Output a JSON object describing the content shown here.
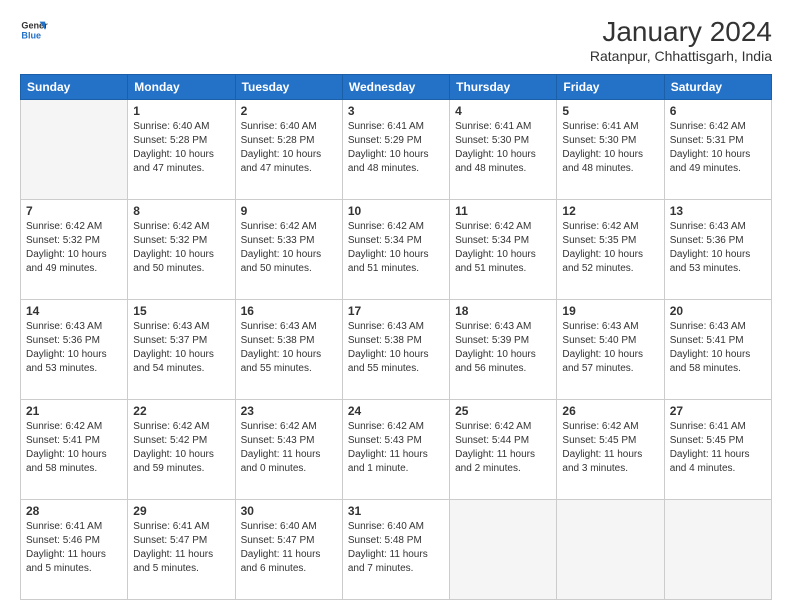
{
  "header": {
    "logo_line1": "General",
    "logo_line2": "Blue",
    "month_year": "January 2024",
    "location": "Ratanpur, Chhattisgarh, India"
  },
  "weekdays": [
    "Sunday",
    "Monday",
    "Tuesday",
    "Wednesday",
    "Thursday",
    "Friday",
    "Saturday"
  ],
  "weeks": [
    [
      {
        "day": "",
        "info": ""
      },
      {
        "day": "1",
        "info": "Sunrise: 6:40 AM\nSunset: 5:28 PM\nDaylight: 10 hours\nand 47 minutes."
      },
      {
        "day": "2",
        "info": "Sunrise: 6:40 AM\nSunset: 5:28 PM\nDaylight: 10 hours\nand 47 minutes."
      },
      {
        "day": "3",
        "info": "Sunrise: 6:41 AM\nSunset: 5:29 PM\nDaylight: 10 hours\nand 48 minutes."
      },
      {
        "day": "4",
        "info": "Sunrise: 6:41 AM\nSunset: 5:30 PM\nDaylight: 10 hours\nand 48 minutes."
      },
      {
        "day": "5",
        "info": "Sunrise: 6:41 AM\nSunset: 5:30 PM\nDaylight: 10 hours\nand 48 minutes."
      },
      {
        "day": "6",
        "info": "Sunrise: 6:42 AM\nSunset: 5:31 PM\nDaylight: 10 hours\nand 49 minutes."
      }
    ],
    [
      {
        "day": "7",
        "info": "Sunrise: 6:42 AM\nSunset: 5:32 PM\nDaylight: 10 hours\nand 49 minutes."
      },
      {
        "day": "8",
        "info": "Sunrise: 6:42 AM\nSunset: 5:32 PM\nDaylight: 10 hours\nand 50 minutes."
      },
      {
        "day": "9",
        "info": "Sunrise: 6:42 AM\nSunset: 5:33 PM\nDaylight: 10 hours\nand 50 minutes."
      },
      {
        "day": "10",
        "info": "Sunrise: 6:42 AM\nSunset: 5:34 PM\nDaylight: 10 hours\nand 51 minutes."
      },
      {
        "day": "11",
        "info": "Sunrise: 6:42 AM\nSunset: 5:34 PM\nDaylight: 10 hours\nand 51 minutes."
      },
      {
        "day": "12",
        "info": "Sunrise: 6:42 AM\nSunset: 5:35 PM\nDaylight: 10 hours\nand 52 minutes."
      },
      {
        "day": "13",
        "info": "Sunrise: 6:43 AM\nSunset: 5:36 PM\nDaylight: 10 hours\nand 53 minutes."
      }
    ],
    [
      {
        "day": "14",
        "info": "Sunrise: 6:43 AM\nSunset: 5:36 PM\nDaylight: 10 hours\nand 53 minutes."
      },
      {
        "day": "15",
        "info": "Sunrise: 6:43 AM\nSunset: 5:37 PM\nDaylight: 10 hours\nand 54 minutes."
      },
      {
        "day": "16",
        "info": "Sunrise: 6:43 AM\nSunset: 5:38 PM\nDaylight: 10 hours\nand 55 minutes."
      },
      {
        "day": "17",
        "info": "Sunrise: 6:43 AM\nSunset: 5:38 PM\nDaylight: 10 hours\nand 55 minutes."
      },
      {
        "day": "18",
        "info": "Sunrise: 6:43 AM\nSunset: 5:39 PM\nDaylight: 10 hours\nand 56 minutes."
      },
      {
        "day": "19",
        "info": "Sunrise: 6:43 AM\nSunset: 5:40 PM\nDaylight: 10 hours\nand 57 minutes."
      },
      {
        "day": "20",
        "info": "Sunrise: 6:43 AM\nSunset: 5:41 PM\nDaylight: 10 hours\nand 58 minutes."
      }
    ],
    [
      {
        "day": "21",
        "info": "Sunrise: 6:42 AM\nSunset: 5:41 PM\nDaylight: 10 hours\nand 58 minutes."
      },
      {
        "day": "22",
        "info": "Sunrise: 6:42 AM\nSunset: 5:42 PM\nDaylight: 10 hours\nand 59 minutes."
      },
      {
        "day": "23",
        "info": "Sunrise: 6:42 AM\nSunset: 5:43 PM\nDaylight: 11 hours\nand 0 minutes."
      },
      {
        "day": "24",
        "info": "Sunrise: 6:42 AM\nSunset: 5:43 PM\nDaylight: 11 hours\nand 1 minute."
      },
      {
        "day": "25",
        "info": "Sunrise: 6:42 AM\nSunset: 5:44 PM\nDaylight: 11 hours\nand 2 minutes."
      },
      {
        "day": "26",
        "info": "Sunrise: 6:42 AM\nSunset: 5:45 PM\nDaylight: 11 hours\nand 3 minutes."
      },
      {
        "day": "27",
        "info": "Sunrise: 6:41 AM\nSunset: 5:45 PM\nDaylight: 11 hours\nand 4 minutes."
      }
    ],
    [
      {
        "day": "28",
        "info": "Sunrise: 6:41 AM\nSunset: 5:46 PM\nDaylight: 11 hours\nand 5 minutes."
      },
      {
        "day": "29",
        "info": "Sunrise: 6:41 AM\nSunset: 5:47 PM\nDaylight: 11 hours\nand 5 minutes."
      },
      {
        "day": "30",
        "info": "Sunrise: 6:40 AM\nSunset: 5:47 PM\nDaylight: 11 hours\nand 6 minutes."
      },
      {
        "day": "31",
        "info": "Sunrise: 6:40 AM\nSunset: 5:48 PM\nDaylight: 11 hours\nand 7 minutes."
      },
      {
        "day": "",
        "info": ""
      },
      {
        "day": "",
        "info": ""
      },
      {
        "day": "",
        "info": ""
      }
    ]
  ]
}
